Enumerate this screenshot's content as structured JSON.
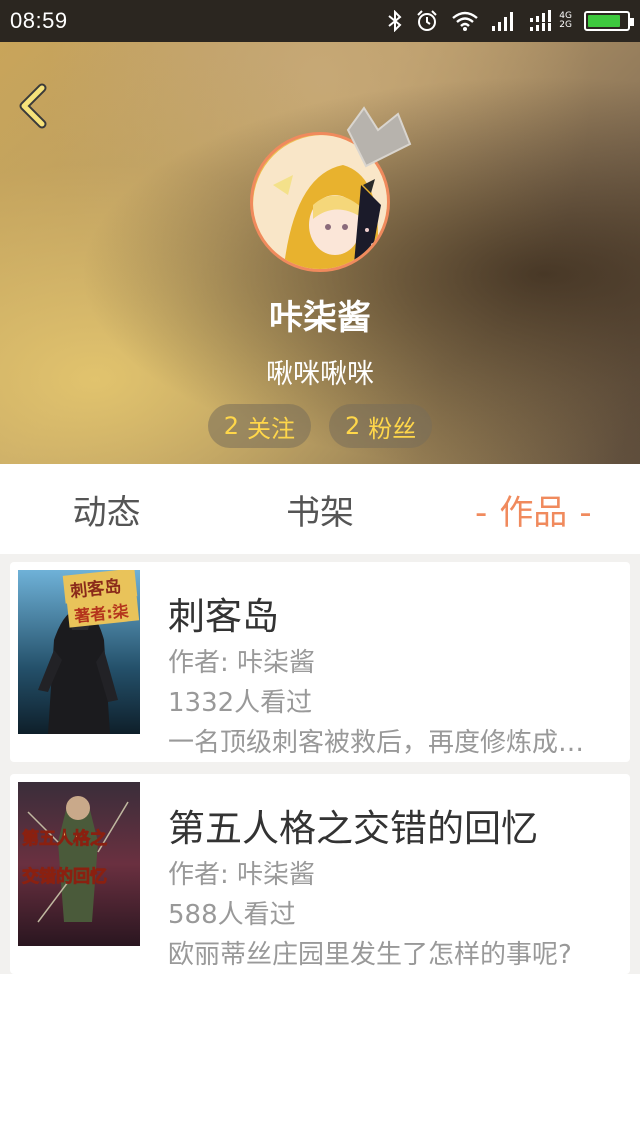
{
  "status_bar": {
    "time": "08:59",
    "network_top": "4G",
    "network_bottom": "2G",
    "icons": [
      "bluetooth-icon",
      "alarm-icon",
      "wifi-icon",
      "signal-icon",
      "signal-icon",
      "battery-icon"
    ],
    "battery_level": 0.85,
    "battery_color": "#3ec93e"
  },
  "profile": {
    "username": "咔柒酱",
    "signature": "啾咪啾咪",
    "following_count": "2",
    "following_label": "关注",
    "followers_count": "2",
    "followers_label": "粉丝"
  },
  "tabs": {
    "items": [
      {
        "label": "动态",
        "active": false
      },
      {
        "label": "书架",
        "active": false
      },
      {
        "label": "作品",
        "active": true
      }
    ],
    "active_dash": "-",
    "active_color": "#f08a5d"
  },
  "books": [
    {
      "title": "刺客岛",
      "author": "作者: 咔柒酱",
      "views": "1332人看过",
      "description": "一名顶级刺客被救后，再度修炼成为更强的刺客的故事",
      "cover_title": "刺客岛",
      "cover_author": "著者:柒"
    },
    {
      "title": "第五人格之交错的回忆",
      "author": "作者: 咔柒酱",
      "views": "588人看过",
      "description": "欧丽蒂丝庄园里发生了怎样的事呢?",
      "cover_line1": "第五人格之",
      "cover_line2": "交错的回忆"
    }
  ]
}
